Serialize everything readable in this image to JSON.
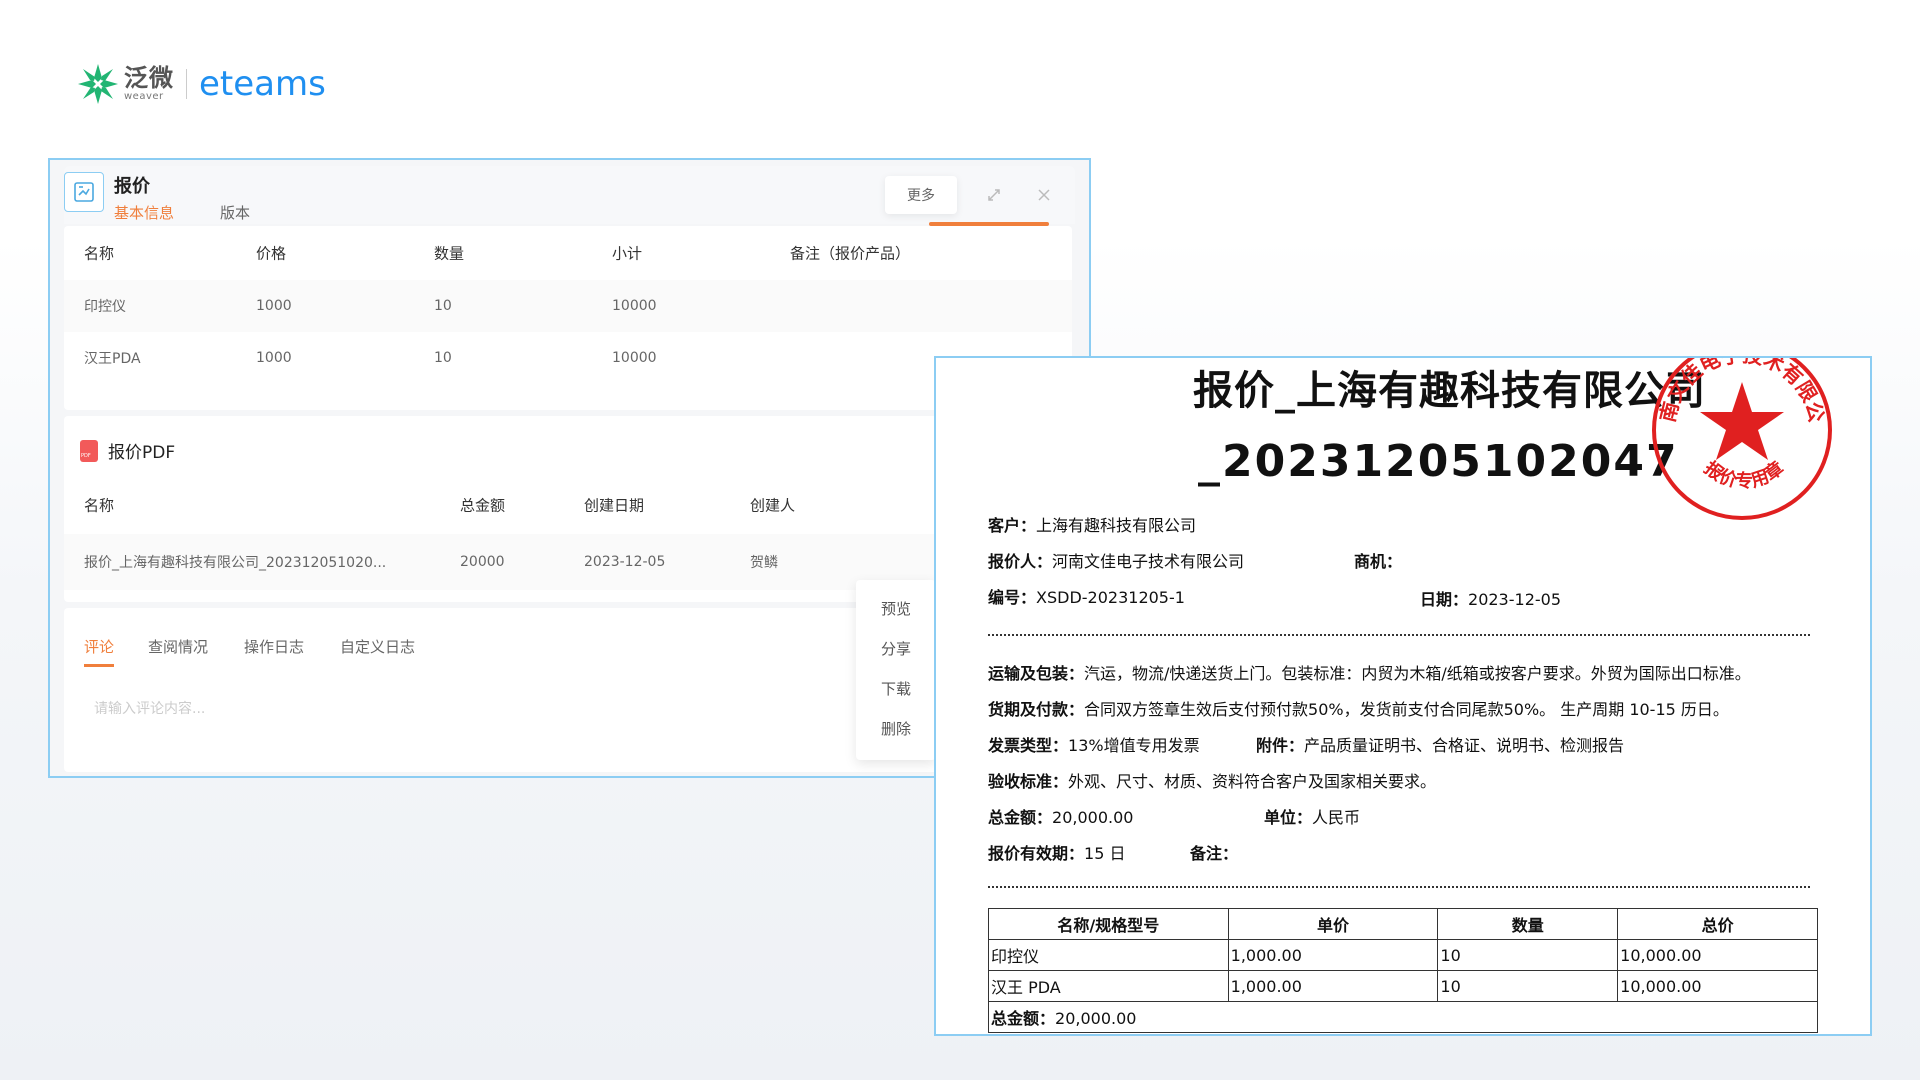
{
  "brand": {
    "logo_cn": "泛微",
    "logo_en_small": "weaver",
    "product": "eteams"
  },
  "window": {
    "title": "报价",
    "tabs": [
      {
        "label": "基本信息",
        "active": true
      },
      {
        "label": "版本",
        "active": false
      }
    ],
    "more_label": "更多",
    "icons": {
      "expand": "expand-icon",
      "close": "close-icon"
    },
    "accent": "#f07f3c",
    "border": "#8ccdf3"
  },
  "products_table": {
    "headers": [
      "名称",
      "价格",
      "数量",
      "小计",
      "备注（报价产品）"
    ],
    "rows": [
      [
        "印控仪",
        "1000",
        "10",
        "10000",
        ""
      ],
      [
        "汉王PDA",
        "1000",
        "10",
        "10000",
        ""
      ]
    ]
  },
  "pdf_section": {
    "title": "报价PDF",
    "headers": [
      "名称",
      "总金额",
      "创建日期",
      "创建人"
    ],
    "rows": [
      [
        "报价_上海有趣科技有限公司_202312051020...",
        "20000",
        "2023-12-05",
        "贺鳞"
      ]
    ]
  },
  "context_menu": {
    "items": [
      "预览",
      "分享",
      "下载",
      "删除"
    ]
  },
  "comments": {
    "tabs": [
      {
        "label": "评论",
        "active": true
      },
      {
        "label": "查阅情况",
        "active": false
      },
      {
        "label": "操作日志",
        "active": false
      },
      {
        "label": "自定义日志",
        "active": false
      }
    ],
    "placeholder": "请输入评论内容..."
  },
  "document": {
    "title_line1": "报价_上海有趣科技有限公司",
    "title_line2": "_20231205102047",
    "seal": {
      "top_text": "河南文佳电子技术有限公司",
      "bottom_text": "报价专用章",
      "color": "#e02020"
    },
    "fields": {
      "customer": {
        "k": "客户：",
        "v": "上海有趣科技有限公司"
      },
      "quoter": {
        "k": "报价人：",
        "v": "河南文佳电子技术有限公司"
      },
      "opportunity": {
        "k": "商机：",
        "v": ""
      },
      "number": {
        "k": "编号：",
        "v": "XSDD-20231205-1"
      },
      "date": {
        "k": "日期：",
        "v": "2023-12-05"
      },
      "shipping": {
        "k": "运输及包装：",
        "v": "汽运，物流/快递送货上门。包装标准：内贸为木箱/纸箱或按客户要求。外贸为国际出口标准。"
      },
      "payment": {
        "k": "货期及付款：",
        "v": "合同双方签章生效后支付预付款50%，发货前支付合同尾款50%。 生产周期 10-15 历日。"
      },
      "invoice": {
        "k": "发票类型：",
        "v": "13%增值专用发票"
      },
      "attachment": {
        "k": "附件：",
        "v": "产品质量证明书、合格证、说明书、检测报告"
      },
      "acceptance": {
        "k": "验收标准：",
        "v": "外观、尺寸、材质、资料符合客户及国家相关要求。"
      },
      "total": {
        "k": "总金额：",
        "v": "20,000.00"
      },
      "unit": {
        "k": "单位：",
        "v": "人民币"
      },
      "validity": {
        "k": "报价有效期：",
        "v": "15 日"
      },
      "remark": {
        "k": "备注：",
        "v": ""
      }
    },
    "table": {
      "headers": [
        "名称/规格型号",
        "单价",
        "数量",
        "总价"
      ],
      "rows": [
        [
          "印控仪",
          "1,000.00",
          "10",
          "10,000.00"
        ],
        [
          "汉王 PDA",
          "1,000.00",
          "10",
          "10,000.00"
        ]
      ],
      "total_label": "总金额：",
      "total_value": "20,000.00"
    }
  }
}
